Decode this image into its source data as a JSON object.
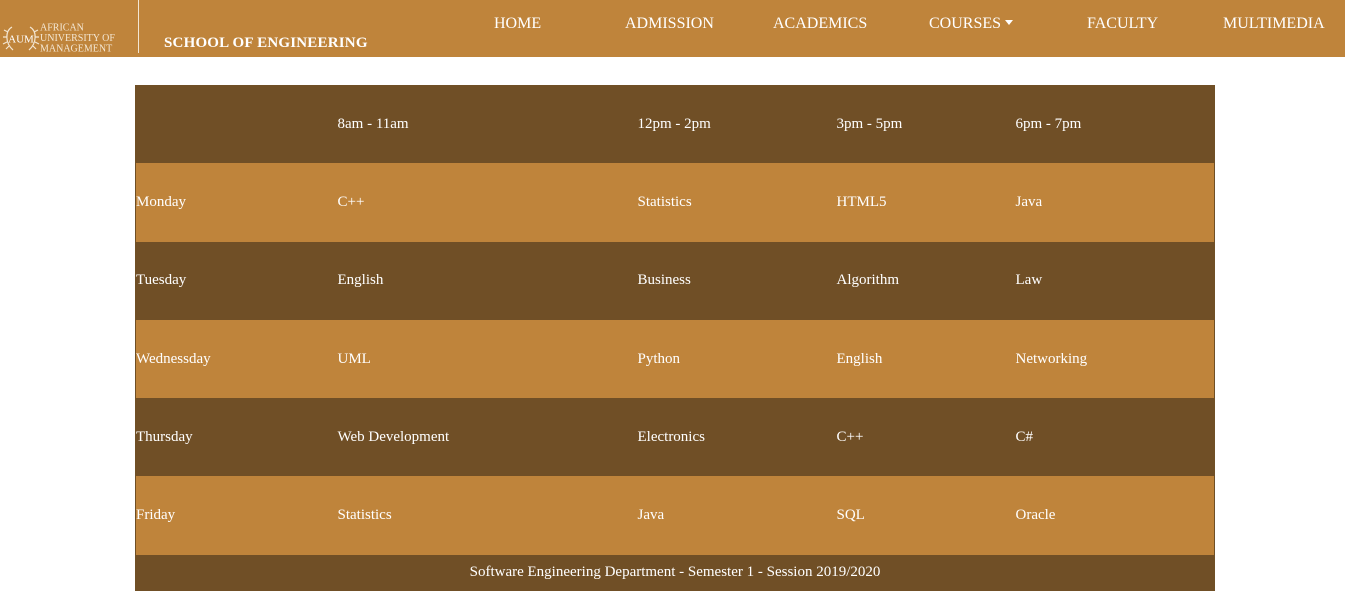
{
  "logo": {
    "badge_text": "AUM",
    "line1": "AFRICAN",
    "line2": "UNIVERSITY OF",
    "line3": "MANAGEMENT"
  },
  "header": {
    "school_title": "SCHOOL OF ENGINEERING"
  },
  "nav": {
    "items": [
      {
        "label": "HOME"
      },
      {
        "label": "ADMISSION"
      },
      {
        "label": "ACADEMICS"
      },
      {
        "label": "COURSES"
      },
      {
        "label": "FACULTY"
      },
      {
        "label": "MULTIMEDIA"
      }
    ]
  },
  "timetable": {
    "columns": [
      "",
      "8am - 11am",
      "12pm - 2pm",
      "3pm - 5pm",
      "6pm - 7pm"
    ],
    "rows": [
      {
        "day": "Monday",
        "cells": [
          "C++",
          "Statistics",
          "HTML5",
          "Java"
        ]
      },
      {
        "day": "Tuesday",
        "cells": [
          "English",
          "Business",
          "Algorithm",
          "Law"
        ]
      },
      {
        "day": "Wednessday",
        "cells": [
          "UML",
          "Python",
          "English",
          "Networking"
        ]
      },
      {
        "day": "Thursday",
        "cells": [
          "Web Development",
          "Electronics",
          "C++",
          "C#"
        ]
      },
      {
        "day": "Friday",
        "cells": [
          "Statistics",
          "Java",
          "SQL",
          "Oracle"
        ]
      }
    ],
    "footer": "Software Engineering Department - Semester 1 - Session 2019/2020"
  },
  "colors": {
    "nav_bg": "#bf843b",
    "row_dark": "#704f26",
    "row_light": "#bf843b",
    "text": "#ffffff"
  }
}
